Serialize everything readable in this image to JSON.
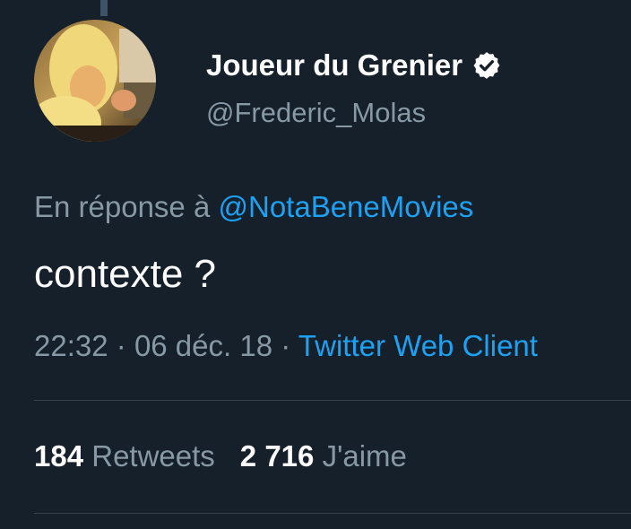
{
  "tweet": {
    "display_name": "Joueur du Grenier",
    "verified": true,
    "handle": "@Frederic_Molas",
    "reply_prefix": "En réponse à",
    "reply_mention": "@NotaBeneMovies",
    "text": "contexte ?",
    "time": "22:32",
    "date": "06 déc. 18",
    "client": "Twitter Web Client",
    "retweets_count": "184",
    "retweets_label": "Retweets",
    "likes_count": "2 716",
    "likes_label": "J'aime"
  },
  "colors": {
    "background": "#15202b",
    "secondary_text": "#8899a6",
    "link": "#1da1f2",
    "divider": "#38444d"
  },
  "icons": [
    "verified-badge-icon"
  ]
}
